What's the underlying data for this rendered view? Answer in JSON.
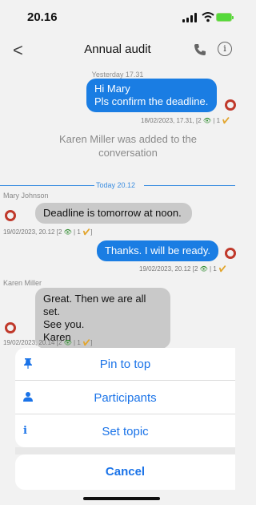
{
  "status": {
    "time": "20.16"
  },
  "nav": {
    "back": "<",
    "title": "Annual audit",
    "info": "i"
  },
  "messages": {
    "m1_date": "Yesterday 17.31",
    "m1_line1": "Hi Mary",
    "m1_line2": "Pls confirm the deadline.",
    "m1_meta_time": "18/02/2023, 17.31",
    "m1_meta_views": "[2",
    "m1_meta_sep": "| 1",
    "system": "Karen Miller was added to the conversation",
    "today_label": "Today 20.12",
    "m2_sender": "Mary Johnson",
    "m2_text": "Deadline is tomorrow at noon.",
    "m2_meta_time": "19/02/2023, 20.12",
    "m2_meta_views": "[2",
    "m2_meta_sep": "| 1",
    "m2_meta_end": "]",
    "m3_text": "Thanks. I will be ready.",
    "m3_meta_time": "19/02/2023, 20.12",
    "m3_meta_views": "[2",
    "m3_meta_sep": "| 1",
    "m4_sender": "Karen Miller",
    "m4_line1": "Great. Then we are all set.",
    "m4_line2": "See you.",
    "m4_line3": "Karen",
    "m4_meta_time": "19/02/2023, 20.14",
    "m4_meta_views": "[2",
    "m4_meta_sep": "| 1",
    "m4_meta_end": "]"
  },
  "sheet": {
    "pin": "Pin to top",
    "participants": "Participants",
    "topic": "Set topic",
    "cancel": "Cancel"
  },
  "colors": {
    "accent": "#1a73e8",
    "bubble_out": "#1a7de3",
    "bubble_in": "#c9c9c9",
    "avatar_ring": "#c0392b"
  }
}
